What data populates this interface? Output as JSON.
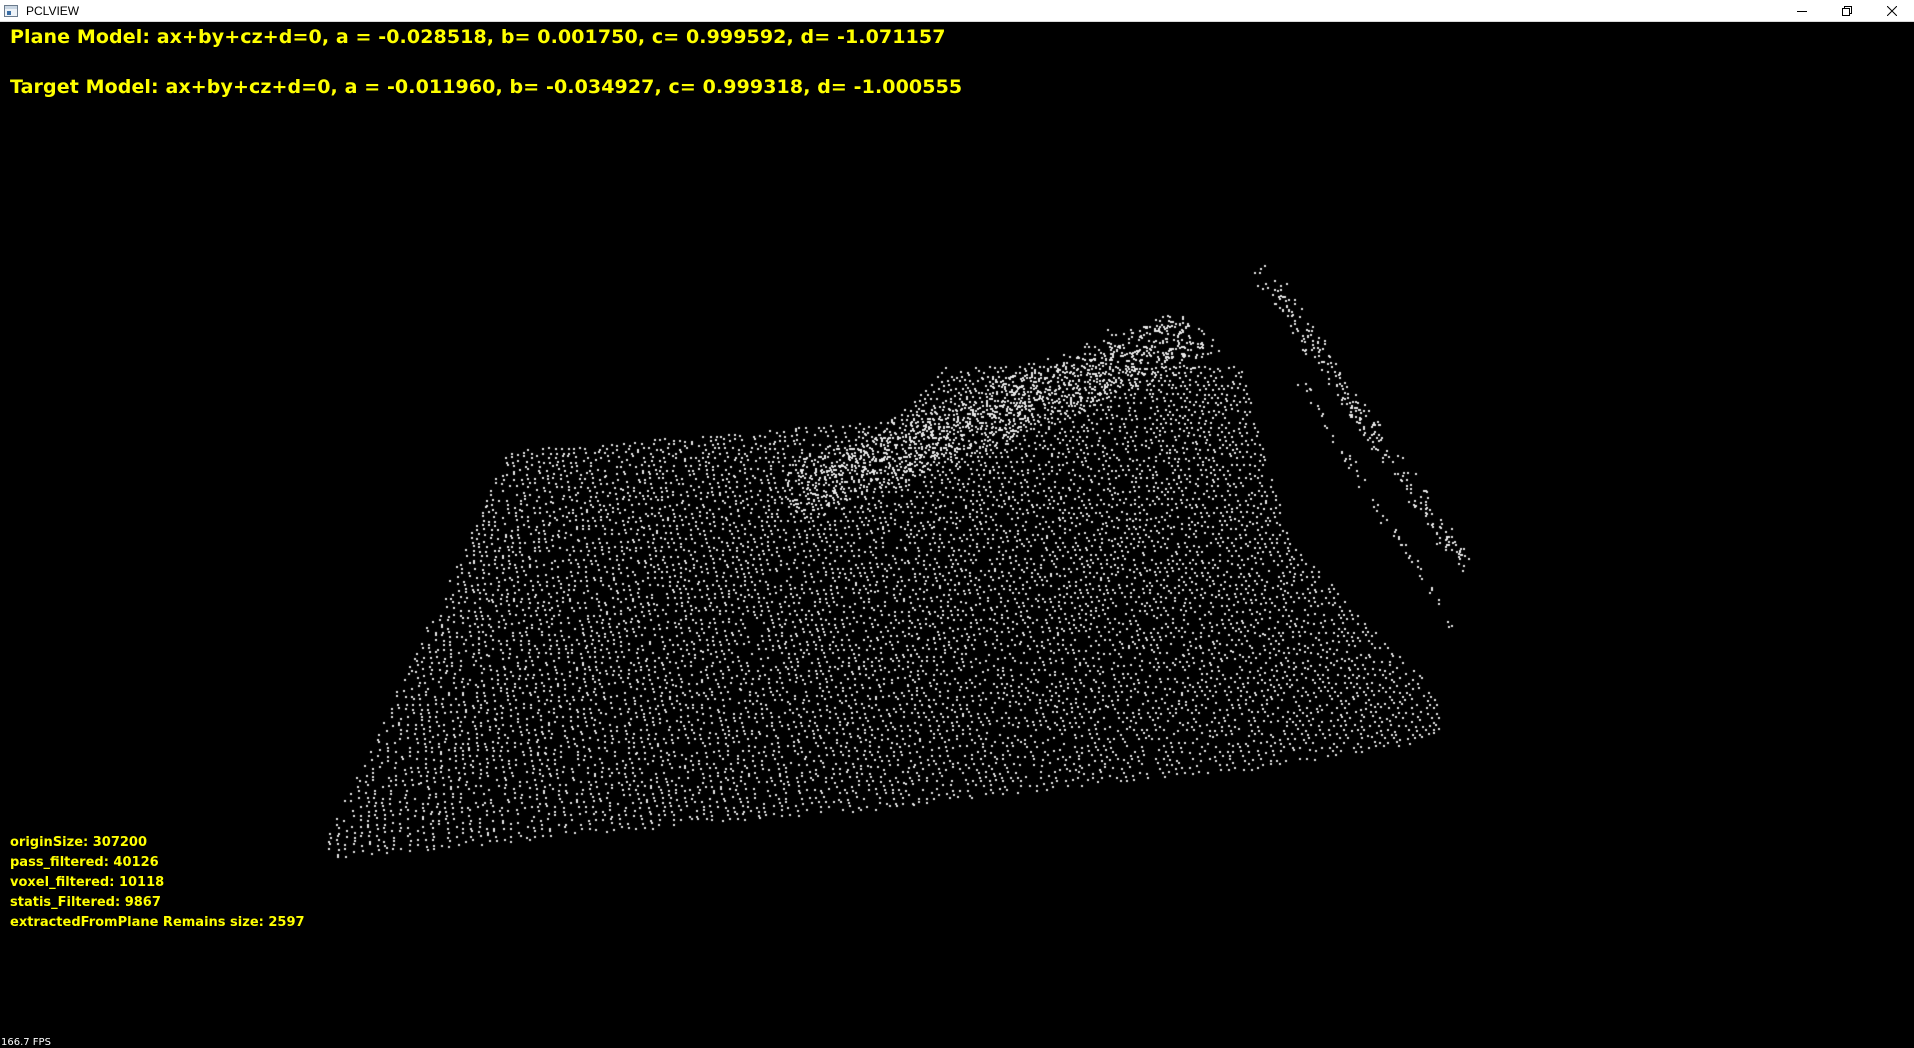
{
  "window": {
    "title": "PCLVIEW",
    "controls": {
      "minimize_icon": "minimize-icon",
      "restore_icon": "restore-icon",
      "close_icon": "close-icon"
    }
  },
  "overlay": {
    "plane_model": "Plane Model: ax+by+cz+d=0, a = -0.028518, b= 0.001750, c= 0.999592, d= -1.071157",
    "target_model": "Target Model: ax+by+cz+d=0, a = -0.011960, b= -0.034927, c= 0.999318, d= -1.000555",
    "stats": [
      "originSize: 307200",
      "pass_filtered: 40126",
      "voxel_filtered: 10118",
      "statis_Filtered: 9867",
      "extractedFromPlane Remains size: 2597"
    ],
    "fps": "166.7 FPS"
  },
  "colors": {
    "background": "#000000",
    "overlay_text": "#ffff00",
    "points": "#e8e8e8"
  }
}
